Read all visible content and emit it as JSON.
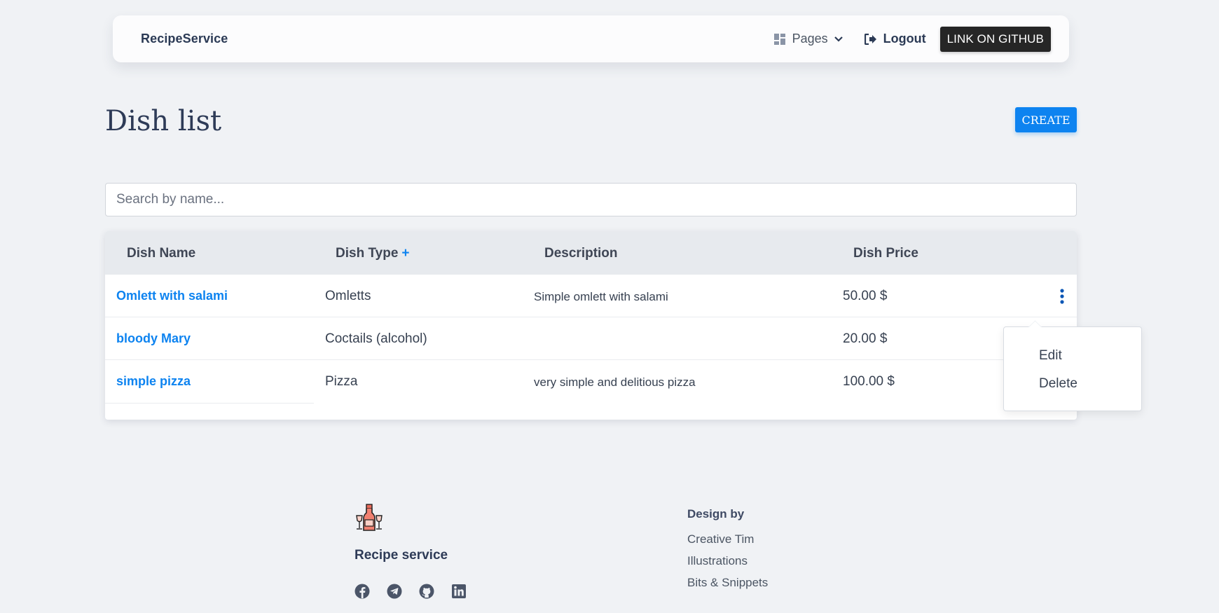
{
  "navbar": {
    "brand": "RecipeService",
    "pages_label": "Pages",
    "logout_label": "Logout",
    "github_label": "LINK ON GITHUB"
  },
  "header": {
    "title": "Dish list",
    "create_label": "CREATE"
  },
  "search": {
    "placeholder": "Search by name..."
  },
  "table": {
    "columns": {
      "name": "Dish Name",
      "type": "Dish Type",
      "type_sort": "+",
      "description": "Description",
      "price": "Dish Price"
    },
    "rows": [
      {
        "name": "Omlett with salami",
        "type": "Omletts",
        "description": "Simple omlett with salami",
        "price": "50.00 $"
      },
      {
        "name": "bloody Mary",
        "type": "Coctails (alcohol)",
        "description": "",
        "price": "20.00 $"
      },
      {
        "name": "simple pizza",
        "type": "Pizza",
        "description": "very simple and delitious pizza",
        "price": "100.00 $"
      }
    ]
  },
  "dropdown": {
    "edit_label": "Edit",
    "delete_label": "Delete"
  },
  "footer": {
    "brand": "Recipe service",
    "design_heading": "Design by",
    "links": [
      "Creative Tim",
      "Illustrations",
      "Bits & Snippets"
    ],
    "social_icons": [
      "facebook-icon",
      "telegram-icon",
      "github-icon",
      "linkedin-icon"
    ]
  },
  "colors": {
    "accent": "#0d83f0",
    "background": "#f0f2f5",
    "github_button": "#262626"
  }
}
